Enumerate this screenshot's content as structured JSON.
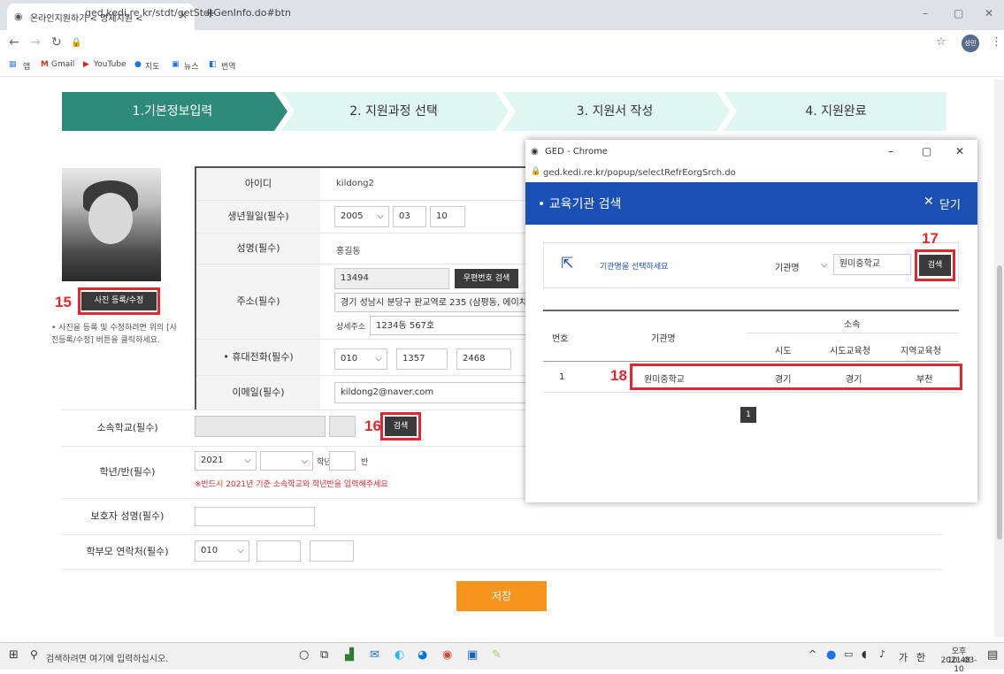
{
  "browser": {
    "tab_title": "온라인지원하기 < 명제지원 < ",
    "new_tab": "+",
    "url": "ged.kedi.re.kr/stdt/getStdtGenInfo.do#btn",
    "bookmarks": [
      "앱",
      "Gmail",
      "YouTube",
      "지도",
      "뉴스",
      "번역"
    ],
    "profile": "성민"
  },
  "steps": [
    {
      "label": "1.기본정보입력",
      "color": "#2e8b7a"
    },
    {
      "label": "2. 지원과정 선택",
      "color": "#dff6f3"
    },
    {
      "label": "3. 지원서 작성",
      "color": "#dff6f3"
    },
    {
      "label": "4. 지원완료",
      "color": "#dff6f3"
    }
  ],
  "photo_panel": {
    "button": "사진 등록/수정",
    "marker": "15",
    "help": "• 사진을 등록 및 수정하려면 위의 [사진등록/수정] 버튼을 클릭하세요."
  },
  "form": {
    "id_label": "아이디",
    "id_value": "kildong2",
    "birth_label": "생년월일(필수)",
    "birth_year": "2005",
    "birth_month": "03",
    "birth_day": "10",
    "name_label": "성명(필수)",
    "name_value": "홍길동",
    "address_label": "주소(필수)",
    "zip": "13494",
    "zip_button": "우편번호 검색",
    "address1": "경기 성남시 분당구 판교역로 235 (삼평동, 에이치",
    "detail_label": "상세주소",
    "address2": "1234동 567호",
    "phone_label": "• 휴대전화(필수)",
    "phone1": "010",
    "phone2": "1357",
    "phone3": "2468",
    "email_label": "이메일(필수)",
    "email_value": "kildong2@naver.com",
    "school_label": "소속학교(필수)",
    "school_search": "검색",
    "school_marker": "16",
    "grade_label": "학년/반(필수)",
    "grade_year": "2021",
    "grade_unit": "학년",
    "class_unit": "반",
    "grade_notice": "※반드시 2021년 기준 소속학교와 학년반을 입력해주세요",
    "guardian_label": "보호자 성명(필수)",
    "parent_phone_label": "학부모 연락처(필수)",
    "parent_phone1": "010",
    "save": "저장"
  },
  "popup": {
    "window_title": "GED - Chrome",
    "url": "ged.kedi.re.kr/popup/selectRefrEorgSrch.do",
    "title": "• 교육기관 검색",
    "close": "닫기",
    "hint": "기관명을 선택하세요",
    "filter": "기관명",
    "query": "원미중학교",
    "search": "검색",
    "search_marker": "17",
    "headers": {
      "no": "번호",
      "org": "기관명",
      "affil": "소속",
      "sido": "시도",
      "office": "시도교육청",
      "region": "지역교육청"
    },
    "rows": [
      {
        "no": "1",
        "org": "원미중학교",
        "sido": "경기",
        "office": "경기",
        "region": "부천"
      }
    ],
    "row_marker": "18",
    "page": "1"
  },
  "taskbar": {
    "search_placeholder": "검색하려면 여기에 입력하십시오.",
    "ime": "가",
    "ime2": "한",
    "time": "오후 10:48",
    "date": "2021-03-10"
  }
}
